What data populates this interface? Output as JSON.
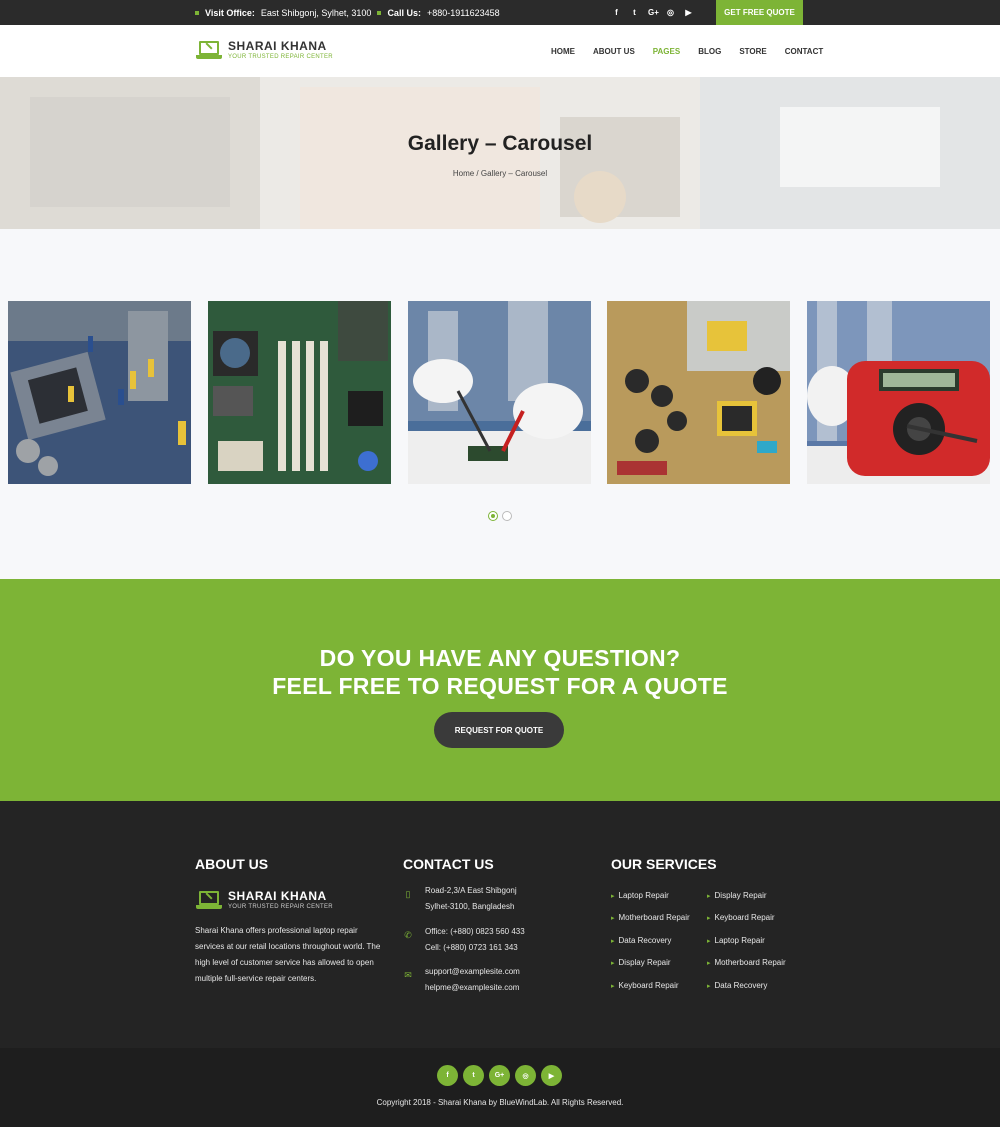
{
  "topbar": {
    "visit_label": "Visit Office:",
    "visit_value": "East Shibgonj, Sylhet, 3100",
    "call_label": "Call Us:",
    "call_value": "+880-1911623458",
    "social": [
      "f",
      "t",
      "G+",
      "ig",
      "yt"
    ],
    "quote_button": "GET FREE QUOTE"
  },
  "brand": {
    "name": "SHARAI KHANA",
    "tagline": "YOUR TRUSTED REPAIR CENTER",
    "accent_color": "#7db436"
  },
  "nav": {
    "items": [
      "HOME",
      "ABOUT US",
      "PAGES",
      "BLOG",
      "STORE",
      "CONTACT"
    ],
    "active": "PAGES"
  },
  "hero": {
    "title": "Gallery – Carousel",
    "breadcrumb": "Home / Gallery – Carousel"
  },
  "gallery": {
    "images": [
      "motherboard-workers-image",
      "motherboard-image",
      "soldering-image",
      "circuit-board-image",
      "multimeter-image"
    ],
    "carousel_page": 1,
    "carousel_pages": 2
  },
  "cta": {
    "line1": "DO YOU HAVE ANY QUESTION?",
    "line2": "FEEL FREE TO REQUEST FOR A QUOTE",
    "button": "REQUEST FOR QUOTE"
  },
  "footer": {
    "about_title": "ABOUT US",
    "about_text": "Sharai Khana offers professional laptop repair services at our retail locations throughout world. The high level of customer service has allowed to open multiple full-service repair centers.",
    "contact_title": "CONTACT US",
    "contact": {
      "address1": "Road-2,3/A East Shibgonj",
      "address2": "Sylhet-3100, Bangladesh",
      "office": "Office: (+880) 0823 560 433",
      "cell": "Cell: (+880) 0723 161 343",
      "email1": "support@examplesite.com",
      "email2": "helpme@examplesite.com"
    },
    "services_title": "OUR SERVICES",
    "services_left": [
      "Laptop Repair",
      "Motherboard Repair",
      "Data Recovery",
      "Display Repair",
      "Keyboard Repair"
    ],
    "services_right": [
      "Display Repair",
      "Keyboard Repair",
      "Laptop Repair",
      "Motherboard Repair",
      "Data Recovery"
    ]
  },
  "bottom": {
    "social": [
      "f",
      "t",
      "G+",
      "ig",
      "yt"
    ],
    "copyright": "Copyright 2018 - Sharai Khana by BlueWindLab. All Rights Reserved."
  }
}
